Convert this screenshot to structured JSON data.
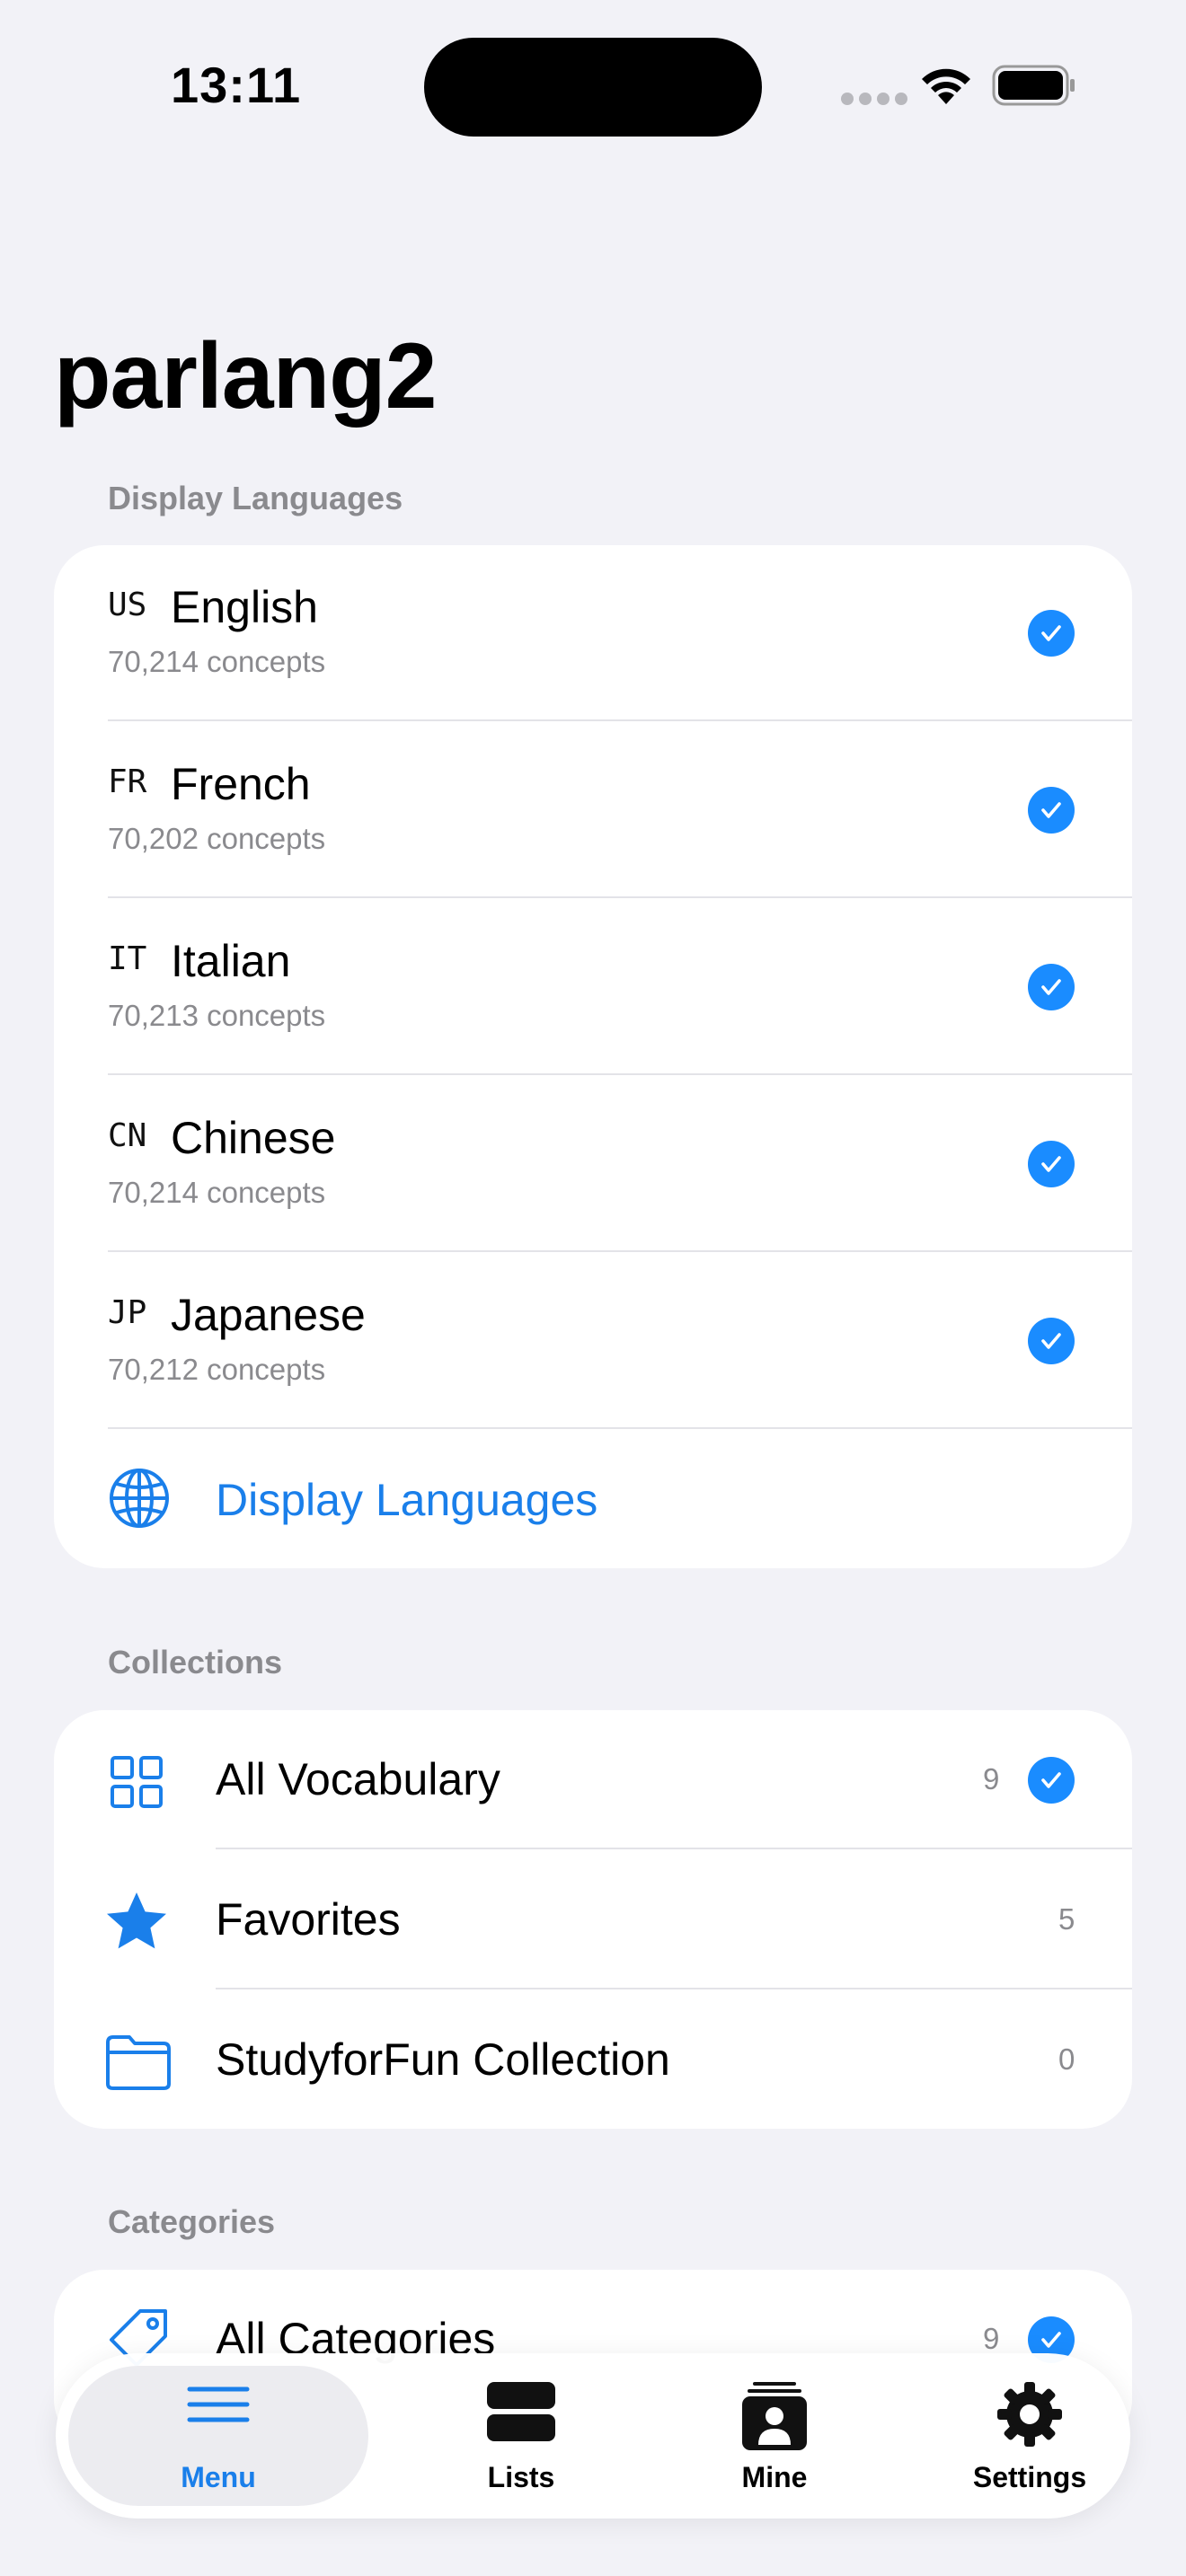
{
  "status_bar": {
    "time": "13:11"
  },
  "app": {
    "title": "parlang2"
  },
  "display_languages": {
    "header": "Display Languages",
    "items": [
      {
        "code": "US",
        "name": "English",
        "count": "70,214 concepts",
        "selected": true
      },
      {
        "code": "FR",
        "name": "French",
        "count": "70,202 concepts",
        "selected": true
      },
      {
        "code": "IT",
        "name": "Italian",
        "count": "70,213 concepts",
        "selected": true
      },
      {
        "code": "CN",
        "name": "Chinese",
        "count": "70,214 concepts",
        "selected": true
      },
      {
        "code": "JP",
        "name": "Japanese",
        "count": "70,212 concepts",
        "selected": true
      }
    ],
    "link_label": "Display Languages"
  },
  "collections": {
    "header": "Collections",
    "items": [
      {
        "label": "All Vocabulary",
        "count": "9",
        "selected": true,
        "icon": "grid-icon"
      },
      {
        "label": "Favorites",
        "count": "5",
        "selected": false,
        "icon": "star-icon"
      },
      {
        "label": "StudyforFun Collection",
        "count": "0",
        "selected": false,
        "icon": "folder-icon"
      }
    ]
  },
  "categories": {
    "header": "Categories",
    "items": [
      {
        "label": "All Categories",
        "count": "9",
        "selected": true,
        "icon": "tag-icon"
      }
    ]
  },
  "tab_bar": {
    "tabs": [
      {
        "label": "Menu",
        "icon": "menu-icon",
        "active": true
      },
      {
        "label": "Lists",
        "icon": "lists-icon",
        "active": false
      },
      {
        "label": "Mine",
        "icon": "person-card-icon",
        "active": false
      },
      {
        "label": "Settings",
        "icon": "gear-icon",
        "active": false
      }
    ]
  },
  "colors": {
    "accent": "#1a8cff",
    "background": "#f2f2f7",
    "secondary_text": "#8a8a8e"
  }
}
